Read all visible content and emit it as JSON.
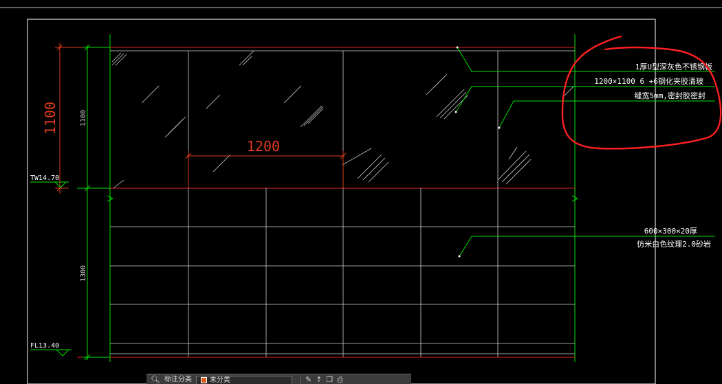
{
  "colors": {
    "background": "#000000",
    "frame": "#ffffff",
    "dimension": "#00e000",
    "dim_red": "#e03c1c",
    "panel_line": "#e02020",
    "annotation": "#ffffff",
    "leader": "#00e000",
    "markup": "#ff2020",
    "grid": "#d0d0d0"
  },
  "drawing": {
    "dim_1100_red": "1100",
    "dim_1100_green": "1100",
    "dim_1300_green": "1300",
    "dim_1200_red": "1200",
    "level_tw": "TW14.70",
    "level_fl": "FL13.40",
    "notes_glass": [
      "1厚U型深灰色不锈钢板",
      "1200×1100  6 +6钢化夹胶清玻",
      "缝宽5mm,密封胶密封"
    ],
    "notes_stone": [
      "600×300×20厚",
      "仿米白色纹理2.0砂岩"
    ]
  },
  "toolbar": {
    "icon_1": "binoculars-icon",
    "label_1": "标注分类",
    "layer_name": "未分类",
    "icon_2": "edit-icon",
    "icon_3": "arrow-icon",
    "icon_4": "copy-icon",
    "icon_5": "print-icon"
  }
}
